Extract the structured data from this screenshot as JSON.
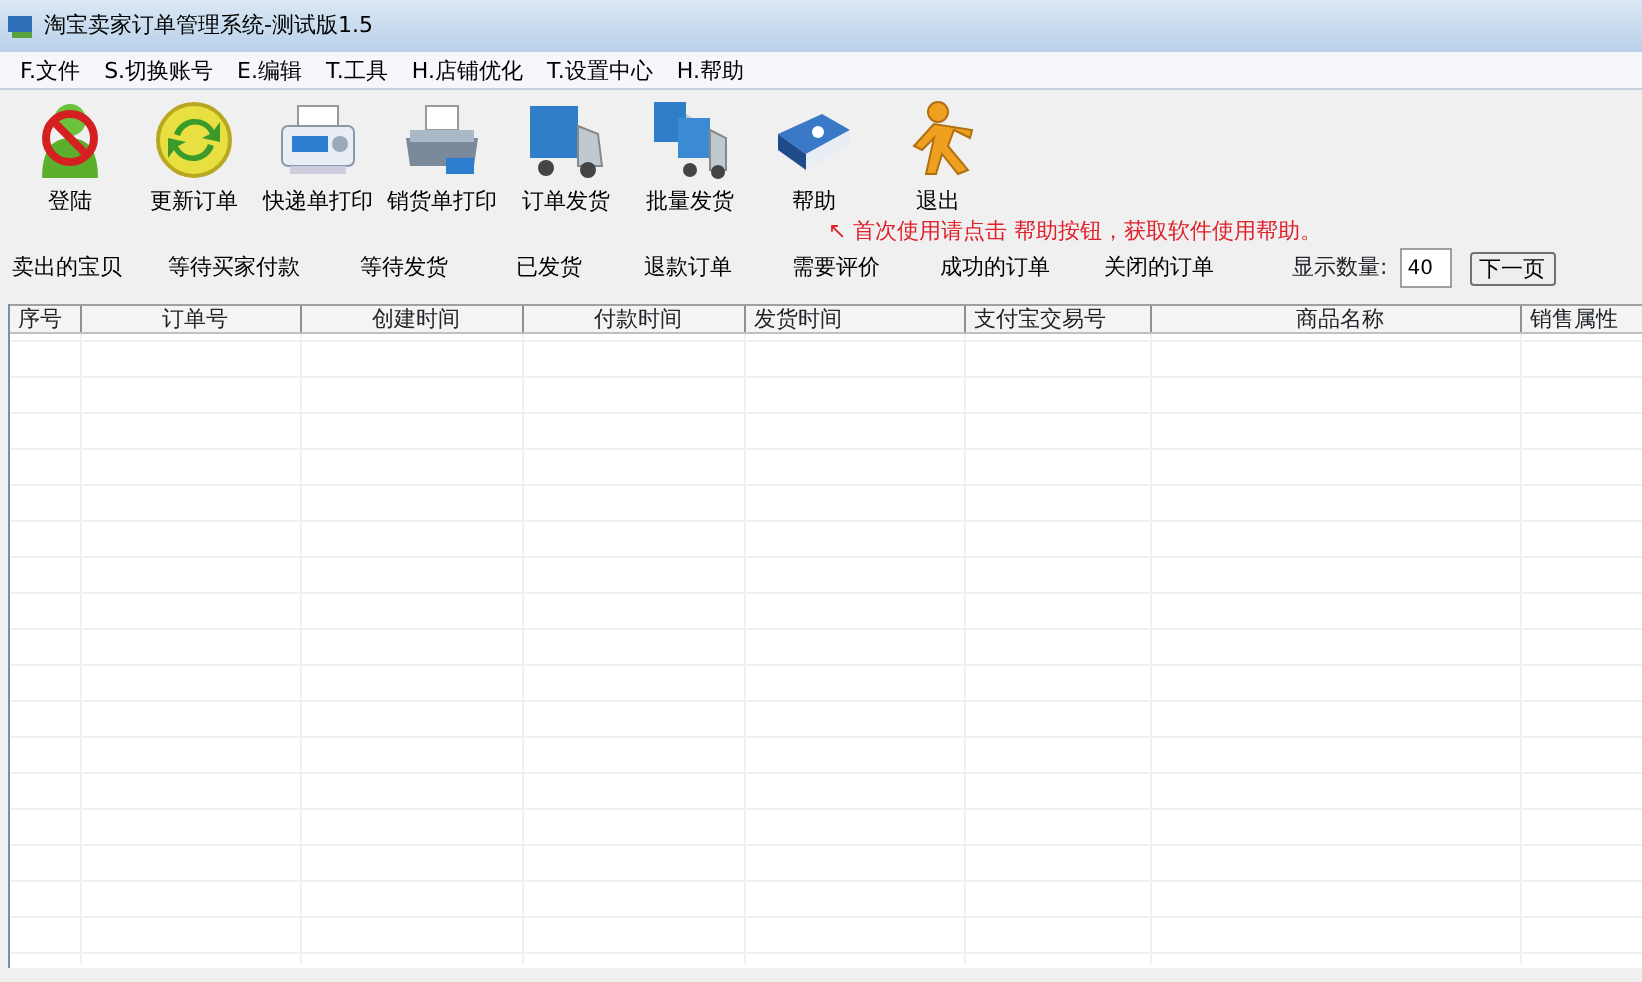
{
  "window": {
    "title": "淘宝卖家订单管理系统-测试版1.5"
  },
  "menu": [
    "F.文件",
    "S.切换账号",
    "E.编辑",
    "T.工具",
    "H.店铺优化",
    "T.设置中心",
    "H.帮助"
  ],
  "toolbar": [
    {
      "label": "登陆",
      "kind": "login"
    },
    {
      "label": "更新订单",
      "kind": "refresh"
    },
    {
      "label": "快递单打印",
      "kind": "express-print"
    },
    {
      "label": "销货单打印",
      "kind": "printer"
    },
    {
      "label": "订单发货",
      "kind": "truck"
    },
    {
      "label": "批量发货",
      "kind": "trucks"
    },
    {
      "label": "帮助",
      "kind": "help"
    },
    {
      "label": "退出",
      "kind": "exit"
    }
  ],
  "hint": "↖ 首次使用请点击 帮助按钮，获取软件使用帮助。",
  "filters": [
    "卖出的宝贝",
    "等待买家付款",
    "等待发货",
    "已发货",
    "退款订单",
    "需要评价",
    "成功的订单",
    "关闭的订单"
  ],
  "page_size": {
    "label": "显示数量:",
    "value": "40"
  },
  "next_button": "下一页",
  "table": {
    "columns": [
      "序号",
      "订单号",
      "创建时间",
      "付款时间",
      "发货时间",
      "支付宝交易号",
      "商品名称",
      "销售属性"
    ]
  }
}
